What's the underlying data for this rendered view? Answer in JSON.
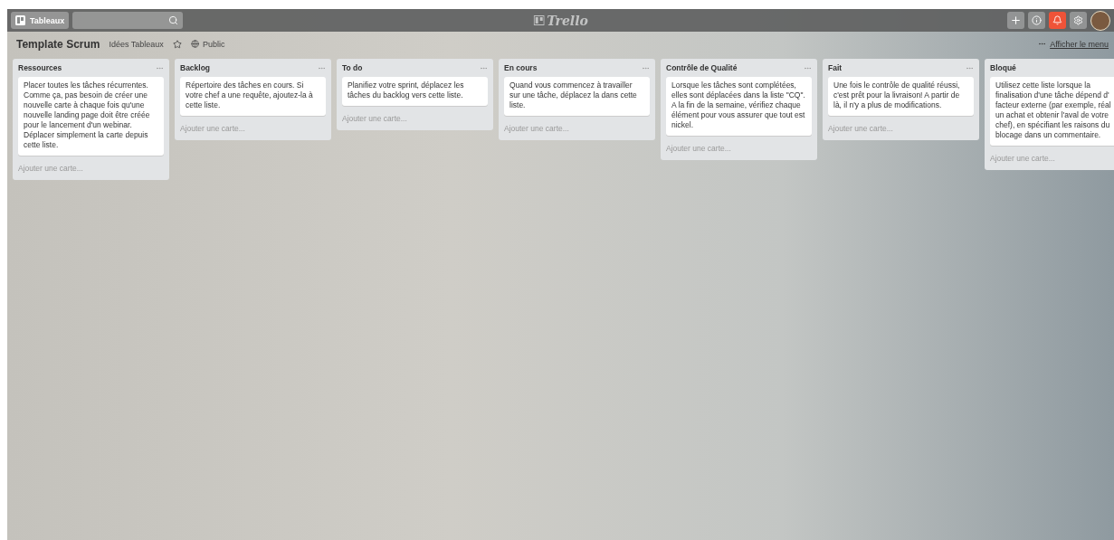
{
  "topbar": {
    "boards_button": "Tableaux",
    "logo": "Trello"
  },
  "board": {
    "title": "Template Scrum",
    "team": "Idées Tableaux",
    "starred": false,
    "visibility": "Public",
    "menu_link": "Afficher le menu"
  },
  "lists": [
    {
      "title": "Ressources",
      "cards": [
        "Placer toutes les tâches récurrentes. Comme ça, pas besoin de créer une nouvelle carte à chaque fois qu'une nouvelle landing page doit être créée pour le lancement d'un webinar. Déplacer simplement la carte depuis cette liste."
      ],
      "add": "Ajouter une carte..."
    },
    {
      "title": "Backlog",
      "cards": [
        "Répertoire des tâches en cours. Si votre chef a une requête, ajoutez-la à cette liste."
      ],
      "add": "Ajouter une carte..."
    },
    {
      "title": "To do",
      "cards": [
        "Planifiez votre sprint, déplacez les tâches du backlog vers cette liste."
      ],
      "add": "Ajouter une carte..."
    },
    {
      "title": "En cours",
      "cards": [
        "Quand vous commencez à travailler sur une tâche, déplacez la dans cette liste."
      ],
      "add": "Ajouter une carte..."
    },
    {
      "title": "Contrôle de Qualité",
      "cards": [
        "Lorsque les tâches sont complétées, elles sont déplacées dans la liste \"CQ\". A la fin de la semaine, vérifiez chaque élément pour vous assurer que tout est nickel."
      ],
      "add": "Ajouter une carte..."
    },
    {
      "title": "Fait",
      "cards": [
        "Une fois le contrôle de qualité réussi, c'est prêt pour la livraison! A partir de là, il n'y a plus de modifications."
      ],
      "add": "Ajouter une carte..."
    },
    {
      "title": "Bloqué",
      "cards": [
        "Utilisez cette liste lorsque la\nfinalisation d'une tâche dépend d'\nfacteur externe (par exemple, réal\nun achat et obtenir l'aval de votre\nchef), en spécifiant les raisons du\nblocage dans un commentaire."
      ],
      "add": "Ajouter une carte..."
    }
  ]
}
